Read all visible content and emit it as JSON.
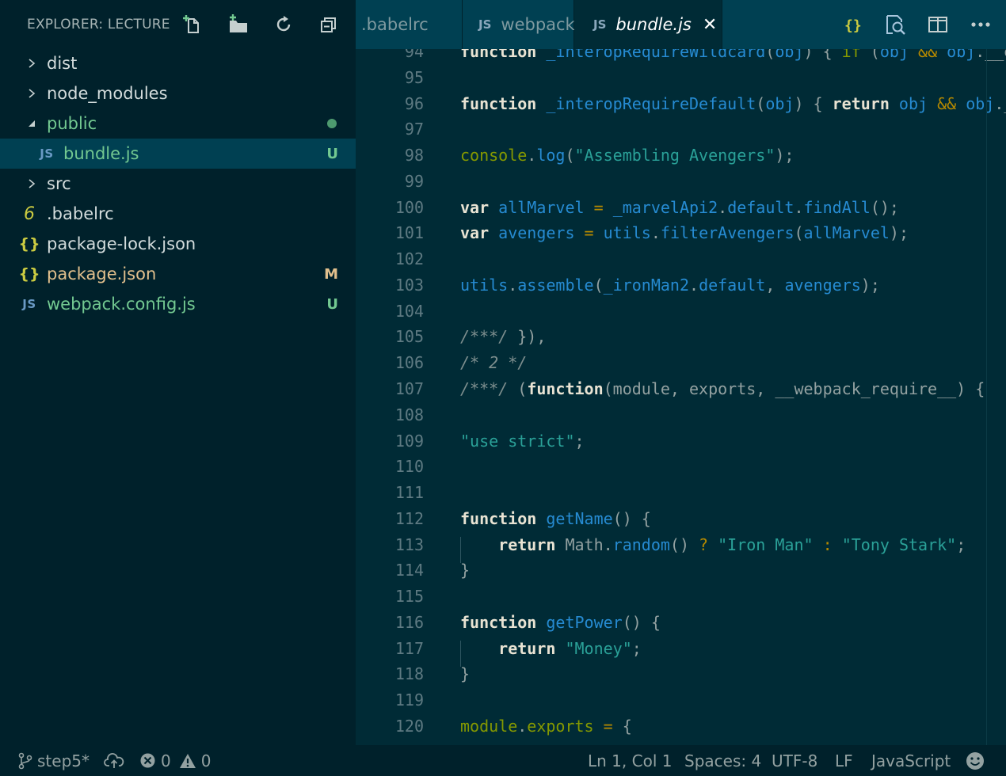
{
  "explorer": {
    "title": "EXPLORER: LECTURE",
    "actions": [
      "new-file-icon",
      "new-folder-icon",
      "refresh-icon",
      "collapse-all-icon"
    ],
    "items": [
      {
        "label": "dist",
        "kind": "folder",
        "expanded": false
      },
      {
        "label": "node_modules",
        "kind": "folder",
        "expanded": false
      },
      {
        "label": "public",
        "kind": "folder",
        "expanded": true,
        "status": "dot"
      },
      {
        "label": "bundle.js",
        "kind": "file",
        "icon": "JS",
        "badge": "U"
      },
      {
        "label": "src",
        "kind": "folder",
        "expanded": false
      },
      {
        "label": ".babelrc",
        "kind": "file",
        "icon": "6"
      },
      {
        "label": "package-lock.json",
        "kind": "file",
        "icon": "{}"
      },
      {
        "label": "package.json",
        "kind": "file",
        "icon": "{}",
        "badge": "M"
      },
      {
        "label": "webpack.config.js",
        "kind": "file",
        "icon": "JS",
        "badge": "U"
      }
    ]
  },
  "tabs": [
    {
      "label": ".babelrc",
      "icon": ""
    },
    {
      "label": "webpack.config.js",
      "icon": "JS"
    },
    {
      "label": "bundle.js",
      "icon": "JS",
      "active": true,
      "close": "✕"
    }
  ],
  "editor": {
    "lines": [
      {
        "n": "94",
        "code": "function _interopRequireWildcard(obj) { if (obj && obj.__esModule"
      },
      {
        "n": "95",
        "code": ""
      },
      {
        "n": "96",
        "code": "function _interopRequireDefault(obj) { return obj && obj.__esModule"
      },
      {
        "n": "97",
        "code": ""
      },
      {
        "n": "98",
        "code": "console.log(\"Assembling Avengers\");"
      },
      {
        "n": "99",
        "code": ""
      },
      {
        "n": "100",
        "code": "var allMarvel = _marvelApi2.default.findAll();"
      },
      {
        "n": "101",
        "code": "var avengers = utils.filterAvengers(allMarvel);"
      },
      {
        "n": "102",
        "code": ""
      },
      {
        "n": "103",
        "code": "utils.assemble(_ironMan2.default, avengers);"
      },
      {
        "n": "104",
        "code": ""
      },
      {
        "n": "105",
        "code": "/***/ }),"
      },
      {
        "n": "106",
        "code": "/* 2 */"
      },
      {
        "n": "107",
        "code": "/***/ (function(module, exports, __webpack_require__) {"
      },
      {
        "n": "108",
        "code": ""
      },
      {
        "n": "109",
        "code": "\"use strict\";"
      },
      {
        "n": "110",
        "code": ""
      },
      {
        "n": "111",
        "code": ""
      },
      {
        "n": "112",
        "code": "function getName() {"
      },
      {
        "n": "113",
        "code": "    return Math.random() ? \"Iron Man\" : \"Tony Stark\";"
      },
      {
        "n": "114",
        "code": "}"
      },
      {
        "n": "115",
        "code": ""
      },
      {
        "n": "116",
        "code": "function getPower() {"
      },
      {
        "n": "117",
        "code": "    return \"Money\";"
      },
      {
        "n": "118",
        "code": "}"
      },
      {
        "n": "119",
        "code": ""
      },
      {
        "n": "120",
        "code": "module.exports = {"
      }
    ]
  },
  "statusbar": {
    "branch": "step5*",
    "errors": "0",
    "warnings": "0",
    "cursor": "Ln 1, Col 1",
    "spaces": "Spaces: 4",
    "encoding": "UTF-8",
    "eol": "LF",
    "language": "JavaScript"
  },
  "colors": {
    "sidebar_bg": "#00212b",
    "editor_bg": "#002b36",
    "selection": "#004052",
    "untracked": "#73c991",
    "modified": "#e2c08d",
    "keyword": "#e8e3d3",
    "function": "#268bd2",
    "string": "#2aa198"
  }
}
